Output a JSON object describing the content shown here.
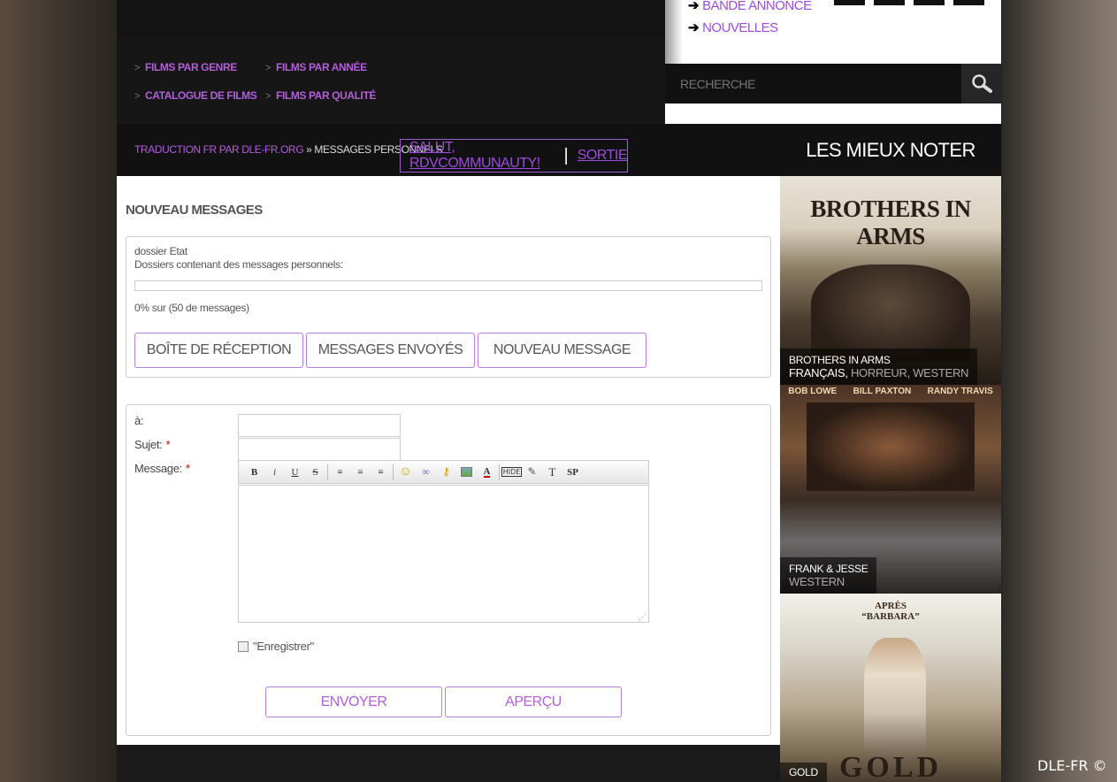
{
  "header": {
    "nav_links": [
      "FILMS PAR GENRE",
      "FILMS PAR ANNÉE",
      "CATALOGUE DE FILMS",
      "FILMS PAR QUALITÉ"
    ],
    "top_links": [
      "BANDE ANNONCE",
      "NOUVELLES"
    ],
    "search_placeholder": "RECHERCHE"
  },
  "breadcrumb": {
    "link": "TRADUCTION FR PAR DLE-FR.ORG",
    "separator": " » ",
    "current": "MESSAGES PERSONNELS"
  },
  "user": {
    "greeting": "SALUT, RDVCOMMUNAUTY!",
    "separator": "|",
    "logout": "SORTIE"
  },
  "page": {
    "title": "NOUVEAU MESSAGES",
    "folder_status_label": "dossier Etat",
    "folder_desc": "Dossiers contenant des messages personnels:",
    "usage": "0% sur (50 de messages)",
    "usage_percent": 0,
    "tabs": [
      "BOÎTE DE RÉCEPTION",
      "MESSAGES ENVOYÉS",
      "NOUVEAU MESSAGE"
    ]
  },
  "form": {
    "to_label": "à:",
    "subject_label": "Sujet:",
    "message_label": "Message:",
    "required_mark": "*",
    "toolbar": [
      "B",
      "i",
      "U",
      "S",
      "align-left",
      "align-center",
      "align-right",
      "smiley",
      "link",
      "key",
      "image",
      "color",
      "HIDE",
      "edit",
      "T",
      "SP"
    ],
    "save_checkbox_label": "\"Enregistrer\"",
    "send_button": "ENVOYER",
    "preview_button": "APERÇU"
  },
  "sidebar": {
    "title": "LES MIEUX NOTER",
    "movies": [
      {
        "title": "BROTHERS IN ARMS",
        "genres": [
          "FRANÇAIS,",
          "HORREUR, WESTERN"
        ]
      },
      {
        "title": "FRANK & JESSE",
        "genres": [
          "WESTERN"
        ]
      },
      {
        "title": "GOLD",
        "genres": []
      }
    ]
  },
  "footer": {
    "copyright": "DLE-FR ©"
  }
}
